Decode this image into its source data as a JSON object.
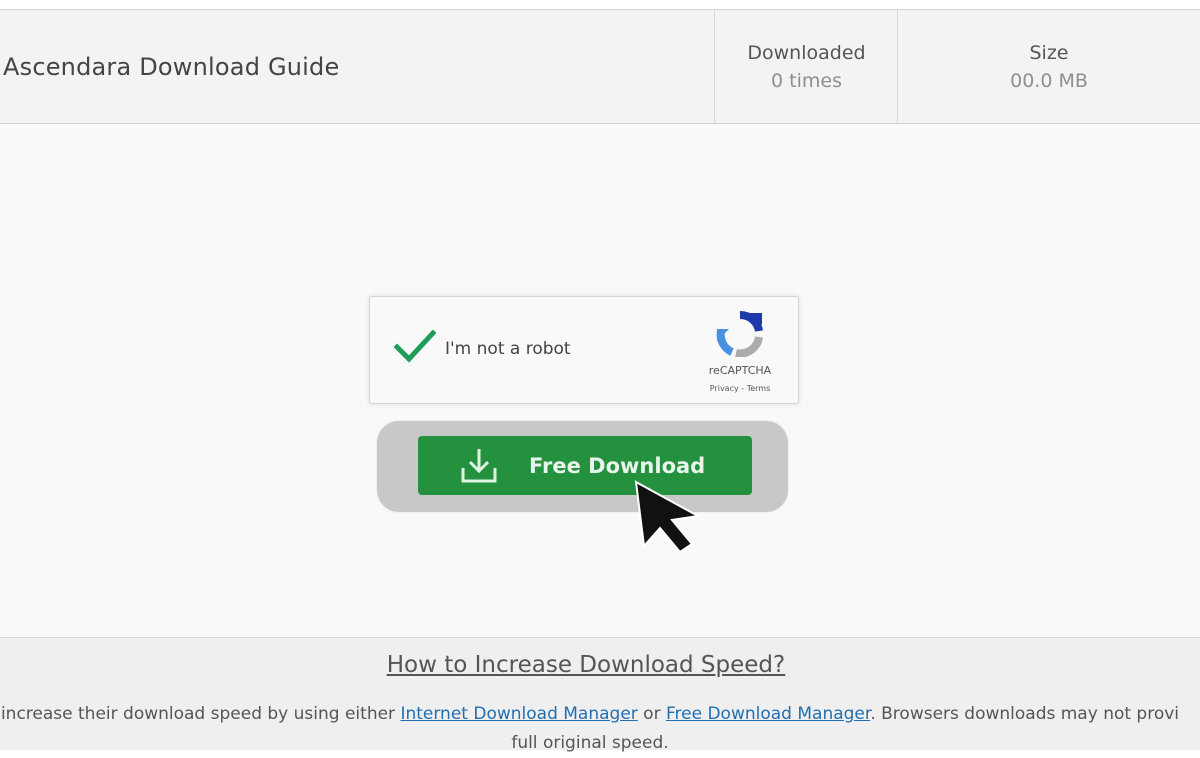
{
  "header": {
    "title": "Ascendara Download Guide",
    "downloaded_label": "Downloaded",
    "downloaded_value": "0 times",
    "size_label": "Size",
    "size_value": "00.0 MB"
  },
  "captcha": {
    "label": "I'm not a robot",
    "brand": "reCAPTCHA",
    "links": "Privacy - Terms",
    "checked": true
  },
  "download": {
    "button_label": "Free Download"
  },
  "footer": {
    "title": "How to Increase Download Speed?",
    "text_prefix": "increase their download speed by using either ",
    "link1": "Internet Download Manager",
    "text_or": " or ",
    "link2": "Free Download Manager",
    "text_suffix": ". Browsers downloads may not provi",
    "text_line2": "full original speed."
  },
  "colors": {
    "accent_green": "#24913f",
    "check_green": "#1e9d59",
    "link_blue": "#1f6fb5"
  }
}
